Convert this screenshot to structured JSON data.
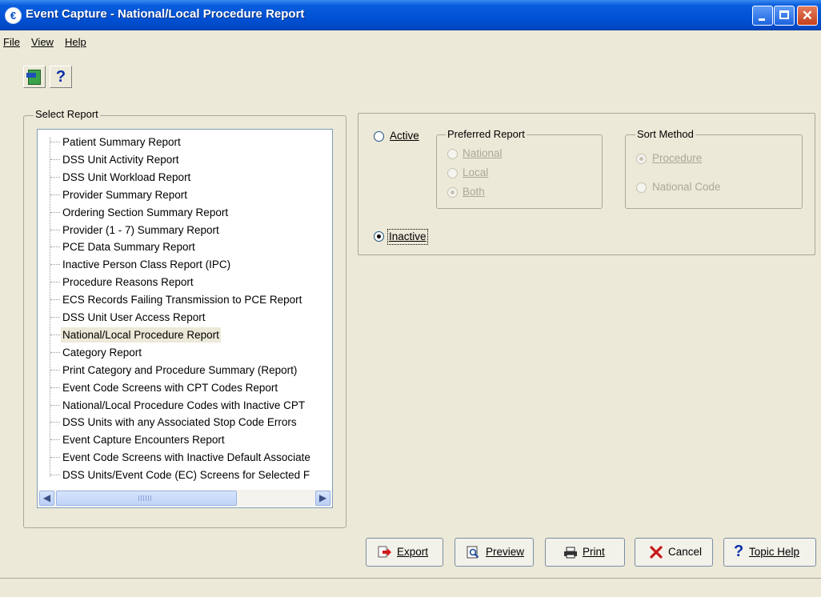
{
  "window": {
    "title": "Event Capture - National/Local Procedure Report"
  },
  "menu": [
    {
      "label": "File"
    },
    {
      "label": "View"
    },
    {
      "label": "Help"
    }
  ],
  "toolbar": {
    "exit_icon": "exit-door-icon",
    "help_label": "?"
  },
  "select_report": {
    "label": "Select Report",
    "items": [
      "Patient Summary Report",
      "DSS Unit Activity Report",
      "DSS Unit Workload Report",
      "Provider Summary Report",
      "Ordering Section Summary Report",
      "Provider (1 - 7) Summary Report",
      "PCE Data Summary Report",
      "Inactive Person Class Report (IPC)",
      "Procedure Reasons Report",
      "ECS Records Failing Transmission to PCE Report",
      "DSS Unit User Access Report",
      "National/Local Procedure Report",
      "Category Report",
      "Print Category and Procedure Summary (Report)",
      "Event Code Screens with CPT Codes Report",
      "National/Local Procedure Codes with Inactive CPT",
      "DSS Units with any Associated Stop Code Errors",
      "Event Capture Encounters Report",
      "Event Code Screens with Inactive Default Associate",
      "DSS Units/Event Code (EC) Screens for Selected F"
    ],
    "selected": "National/Local Procedure Report"
  },
  "options": {
    "active_label": "Active",
    "inactive_label": "Inactive",
    "selected": "Inactive",
    "preferred_report": {
      "label": "Preferred Report",
      "options": [
        "National",
        "Local",
        "Both"
      ],
      "selected": "Both"
    },
    "sort_method": {
      "label": "Sort Method",
      "options": [
        "Procedure",
        "National Code"
      ],
      "selected": "Procedure"
    }
  },
  "buttons": {
    "export": "Export",
    "preview": "Preview",
    "print": "Print",
    "cancel": "Cancel",
    "topic_help": "Topic Help"
  },
  "colors": {
    "titlebar": "#0052d6",
    "face": "#ece9d8",
    "accent_radio": "#21a121"
  }
}
